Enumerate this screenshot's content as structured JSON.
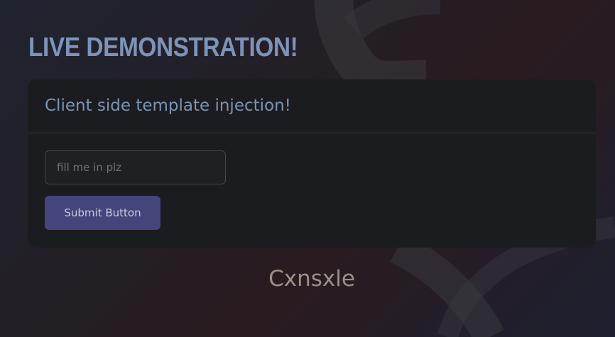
{
  "page": {
    "title": "LIVE DEMONSTRATION!"
  },
  "card": {
    "title": "Client side template injection!",
    "input_placeholder": "fill me in plz",
    "input_value": "",
    "submit_label": "Submit Button"
  },
  "footer": {
    "name": "Cxnsxle"
  },
  "colors": {
    "title": "#7d93b8",
    "card_bg": "#1b1c1f",
    "button_bg": "#44457a",
    "footer_text": "#9a9186"
  }
}
